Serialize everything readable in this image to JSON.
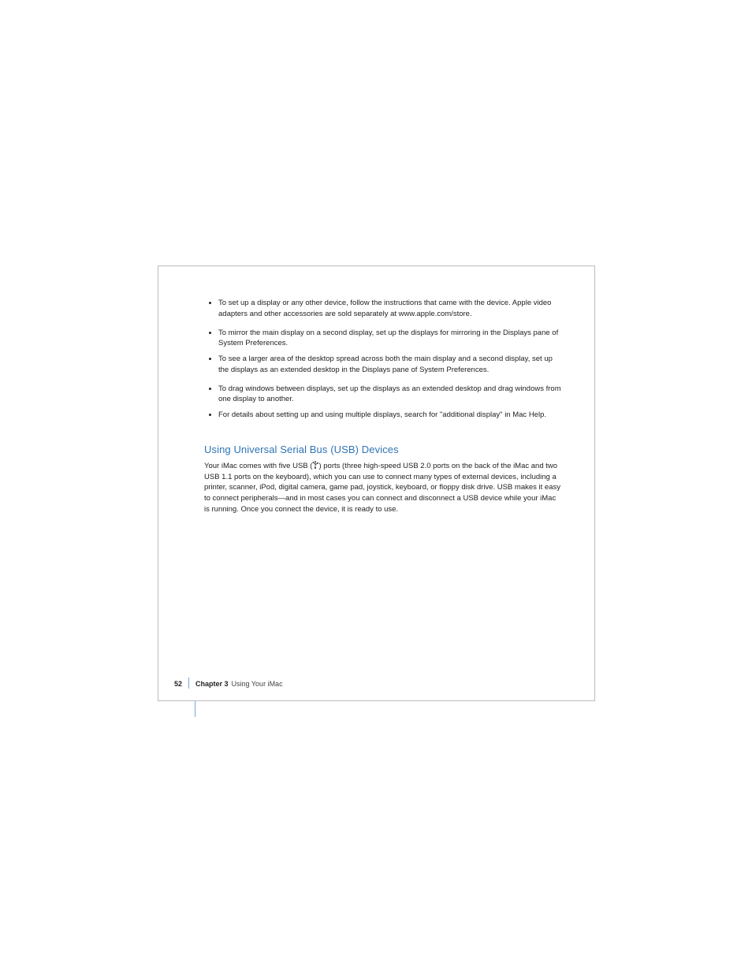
{
  "bullets": [
    "To set up a display or any other device, follow the instructions that came with the device. Apple video adapters and other accessories are sold separately at www.apple.com/store.",
    "To mirror the main display on a second display, set up the displays for mirroring in the Displays pane of System Preferences.",
    "To see a larger area of the desktop spread across both the main display and a second display, set up the displays as an extended desktop in the Displays pane of System Preferences.",
    "To drag windows between displays, set up the displays as an extended desktop and drag windows from one display to another.",
    "For details about setting up and using multiple displays, search for \"additional display\" in Mac Help."
  ],
  "heading": "Using Universal Serial Bus (USB) Devices",
  "body_lead": "Your iMac comes with five USB (",
  "body_mid": ") ports (three high-speed USB 2.0 ports on",
  "body_rest": "the back of the iMac and two USB 1.1 ports on the keyboard), which you can use to connect many types of external devices, including a printer, scanner, iPod, digital camera, game pad, joystick, keyboard, or floppy disk drive. USB makes it easy to connect peripherals—and in most cases you can connect and disconnect a USB device while your iMac is running. Once you connect the device, it is ready to use.",
  "footer": {
    "page": "52",
    "chapter": "Chapter 3",
    "title": "Using Your iMac"
  }
}
